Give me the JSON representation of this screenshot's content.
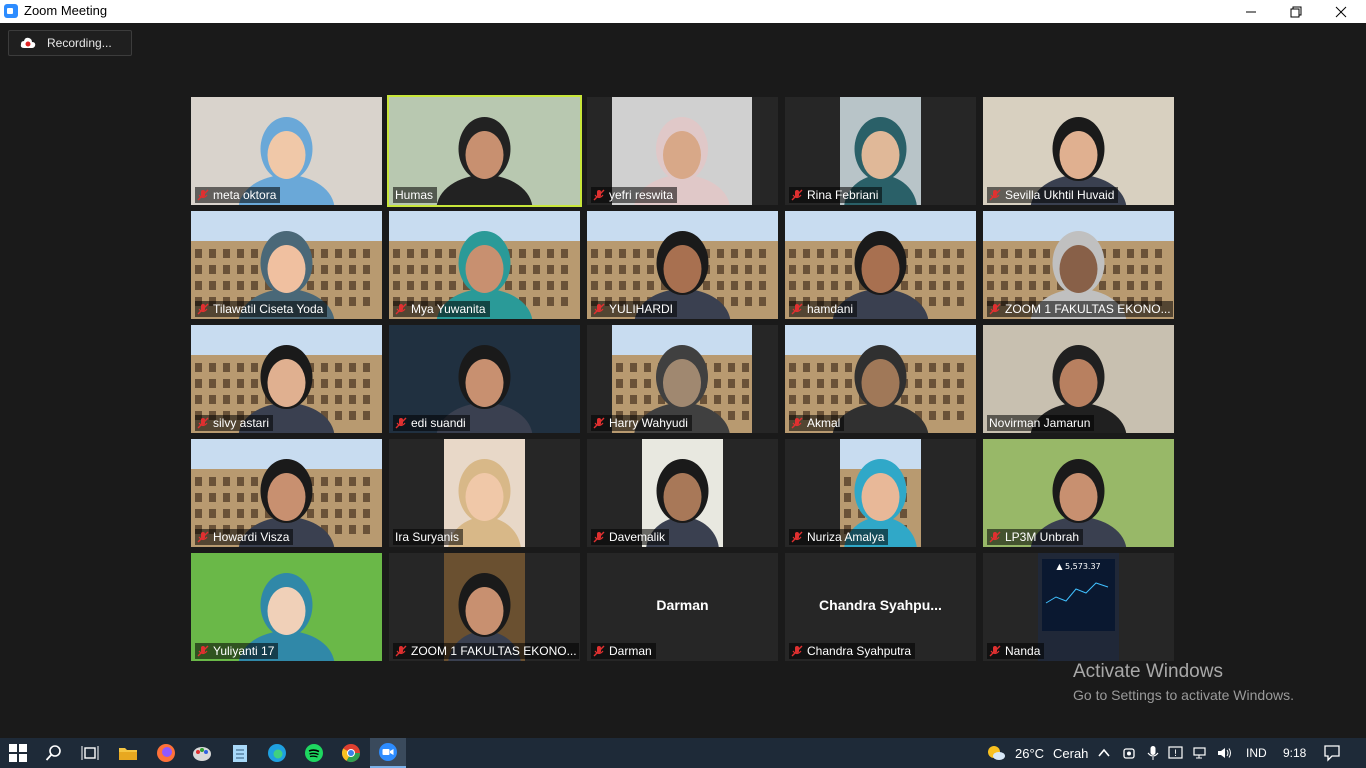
{
  "window": {
    "title": "Zoom Meeting"
  },
  "recording": {
    "label": "Recording..."
  },
  "participants": [
    {
      "name": "meta oktora",
      "muted": true,
      "bg": "#d9d3cc",
      "person": "#f0c8a8",
      "hair": "#6aa8d8"
    },
    {
      "name": "Humas",
      "muted": false,
      "bg": "#b8c8b0",
      "person": "#c89070",
      "hair": "#222222",
      "active": true
    },
    {
      "name": "yefri reswita",
      "muted": true,
      "bg": "#d0d0d0",
      "person": "#d8a888",
      "hair": "#e0c8c8"
    },
    {
      "name": "Rina Febriani",
      "muted": true,
      "bg": "#b8c4c8",
      "person": "#e0b898",
      "hair": "#2a6068"
    },
    {
      "name": "Sevilla Ukhtil Huvaid",
      "muted": true,
      "bg": "#d8d0c0",
      "person": "#e0b090",
      "hair": "#1a1a1a"
    },
    {
      "name": "Tilawatil Ciseta Yoda",
      "muted": true,
      "bg": "#a8c0d8",
      "person": "#f0c0a0",
      "hair": "#4a6878"
    },
    {
      "name": "Mya Yuwanita",
      "muted": true,
      "bg": "#a8c0d8",
      "person": "#c89070",
      "hair": "#2a9a98"
    },
    {
      "name": "YULIHARDI",
      "muted": true,
      "bg": "#a8c0d8",
      "person": "#a87050",
      "hair": "#1a1a1a"
    },
    {
      "name": "hamdani",
      "muted": true,
      "bg": "#a8c0d8",
      "person": "#a87050",
      "hair": "#1a1a1a"
    },
    {
      "name": "ZOOM 1 FAKULTAS EKONO...",
      "muted": true,
      "bg": "#a8c0d8",
      "person": "#886048",
      "hair": "#c0c0c0"
    },
    {
      "name": "silvy astari",
      "muted": true,
      "bg": "#a8c0d8",
      "person": "#e0b090",
      "hair": "#1a1a1a"
    },
    {
      "name": "edi suandi",
      "muted": true,
      "bg": "#203040",
      "person": "#c89070",
      "hair": "#1a1a1a"
    },
    {
      "name": "Harry Wahyudi",
      "muted": true,
      "bg": "#a8c0d8",
      "person": "#a08870",
      "hair": "#404040"
    },
    {
      "name": "Akmal",
      "muted": true,
      "bg": "#a8c0d8",
      "person": "#a07858",
      "hair": "#303030"
    },
    {
      "name": "Novirman Jamarun",
      "muted": false,
      "bg": "#c8c0b0",
      "person": "#b88060",
      "hair": "#202020"
    },
    {
      "name": "Howardi Visza",
      "muted": true,
      "bg": "#a8c0d8",
      "person": "#c89070",
      "hair": "#1a1a1a"
    },
    {
      "name": "Ira Suryanis",
      "muted": false,
      "bg": "#e8d8c8",
      "person": "#f0c8a8",
      "hair": "#d8b888"
    },
    {
      "name": "Davemalik",
      "muted": true,
      "bg": "#e8e8e0",
      "person": "#a87858",
      "hair": "#1a1a1a"
    },
    {
      "name": "Nuriza Amalya",
      "muted": true,
      "bg": "#a8c0d8",
      "person": "#e8b898",
      "hair": "#30a8c8"
    },
    {
      "name": "LP3M Unbrah",
      "muted": true,
      "bg": "#98b868",
      "person": "#c89070",
      "hair": "#1a1a1a"
    },
    {
      "name": "Yuliyanti 17",
      "muted": true,
      "bg": "#6ab848",
      "person": "#f0d0b8",
      "hair": "#3088a8"
    },
    {
      "name": "ZOOM 1 FAKULTAS EKONO...",
      "muted": true,
      "bg": "#6a5030",
      "person": "#c89070",
      "hair": "#1a1a1a"
    },
    {
      "name": "Darman",
      "muted": true,
      "bigname": "Darman"
    },
    {
      "name": "Chandra Syahputra",
      "muted": true,
      "bigname": "Chandra  Syahpu..."
    },
    {
      "name": "Nanda",
      "muted": true,
      "bg": "#202838",
      "person": "#3060a0",
      "hair": "#202838",
      "stock": "5,573.37"
    }
  ],
  "watermark": {
    "line1": "Activate Windows",
    "line2": "Go to Settings to activate Windows."
  },
  "taskbar": {
    "weather_temp": "26°C",
    "weather_text": "Cerah",
    "language": "IND",
    "time": "9:18"
  }
}
